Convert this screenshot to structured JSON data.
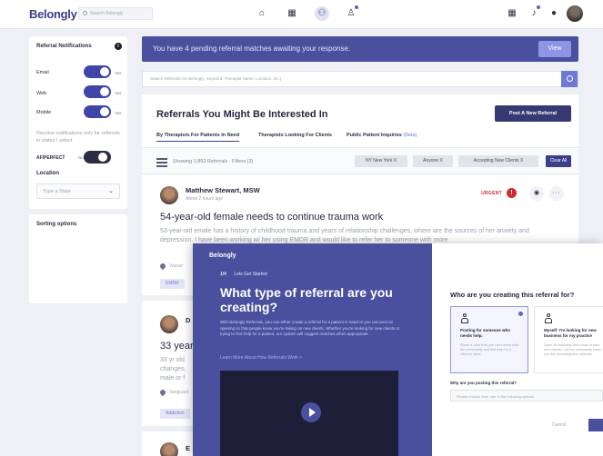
{
  "header": {
    "logo": "Belongly",
    "search_placeholder": "Search Belongly",
    "nav_icons": [
      "home-icon",
      "building-icon",
      "community-icon",
      "user-add-icon"
    ],
    "right_icons": [
      "grid-icon",
      "bell-icon",
      "chat-icon",
      "profile-avatar"
    ]
  },
  "sidebar": {
    "title": "Referral Notifications",
    "toggles": [
      {
        "label": "Email",
        "state": "Yes"
      },
      {
        "label": "Web",
        "state": "Yes"
      },
      {
        "label": "Mobile",
        "state": "Yes"
      }
    ],
    "note": "Receive notifications only for referrals in states I select",
    "af_label": "AF/PERFECT",
    "af_state": "No",
    "location_label": "Location",
    "state_placeholder": "Type a State",
    "sorting_title": "Sorting options"
  },
  "banner": {
    "text": "You have 4 pending referral matches awaiting your response.",
    "button": "View"
  },
  "main_search": {
    "placeholder": "Search Referrals On Belongly, Keyword, Therapist Name, Location, etc.)"
  },
  "referrals": {
    "title": "Referrals You Might Be Interested In",
    "post_button": "Post A New Referral",
    "tabs": [
      {
        "label": "By Therapists For Patients In Need",
        "beta": ""
      },
      {
        "label": "Therapists Looking For Clients",
        "beta": ""
      },
      {
        "label": "Public Patient Inquiries",
        "beta": "(Beta)"
      }
    ],
    "showing": "Showing 1,892 Referrals · Filters (3)",
    "chips": [
      "NY New York X",
      "Anyone X",
      "Accepting New Clients X"
    ],
    "clear_button": "Clear All",
    "items": [
      {
        "author": "Matthew Stewart, MSW",
        "time": "About 2 hours ago",
        "urgent": "URGENT",
        "urgent_mark": "!",
        "eye": "◉",
        "more": "···",
        "headline": "54-year-old  female needs to continue trauma work",
        "body": "53-year-old emale has a history of childhood trauma and years of relationship challenges, where are the sources of her anxiety and depression.  I have been working w/ her using EMDR and would like to refer her to someone with more",
        "location": "Vassar",
        "tag": "EMDR"
      },
      {
        "author": "D",
        "headline": "33 year",
        "body": "33 yr old changes, male or f",
        "location": "Vanguard",
        "tag": "Addiction"
      },
      {
        "author": "E"
      }
    ]
  },
  "modal": {
    "logo": "Belongly",
    "step_num": "1/4",
    "step_label": "Lets Get Started",
    "heading": "What type of referral are you creating?",
    "description": "With Belongly Referrals, you can either create a referral for a patient in need or you can post an opening so that people know you're taking on new clients. Whether you're looking for new clients or trying to find help for a patient, our system will suggest matches when appropriate.",
    "link": "Learn More About How Referrals Work >",
    "question": "Who are you creating this referral for?",
    "options": [
      {
        "title": "Posting for someone who needs help.",
        "desc": "Share a case that you can't serve with the community and find help for a client in need."
      },
      {
        "title": "Myself: I'm looking for new business  for my practice",
        "desc": "Open for business and ready to take new clients? Let the community know you are accepting new referrals."
      }
    ],
    "why_label": "Why are you posting this referral?",
    "why_placeholder": "Please choose from one of the following options",
    "cancel": "Cancel",
    "next": ""
  },
  "colors": {
    "brand": "#3a3e8c",
    "banner": "#4a4f9e",
    "urgent": "#d12b2b"
  }
}
